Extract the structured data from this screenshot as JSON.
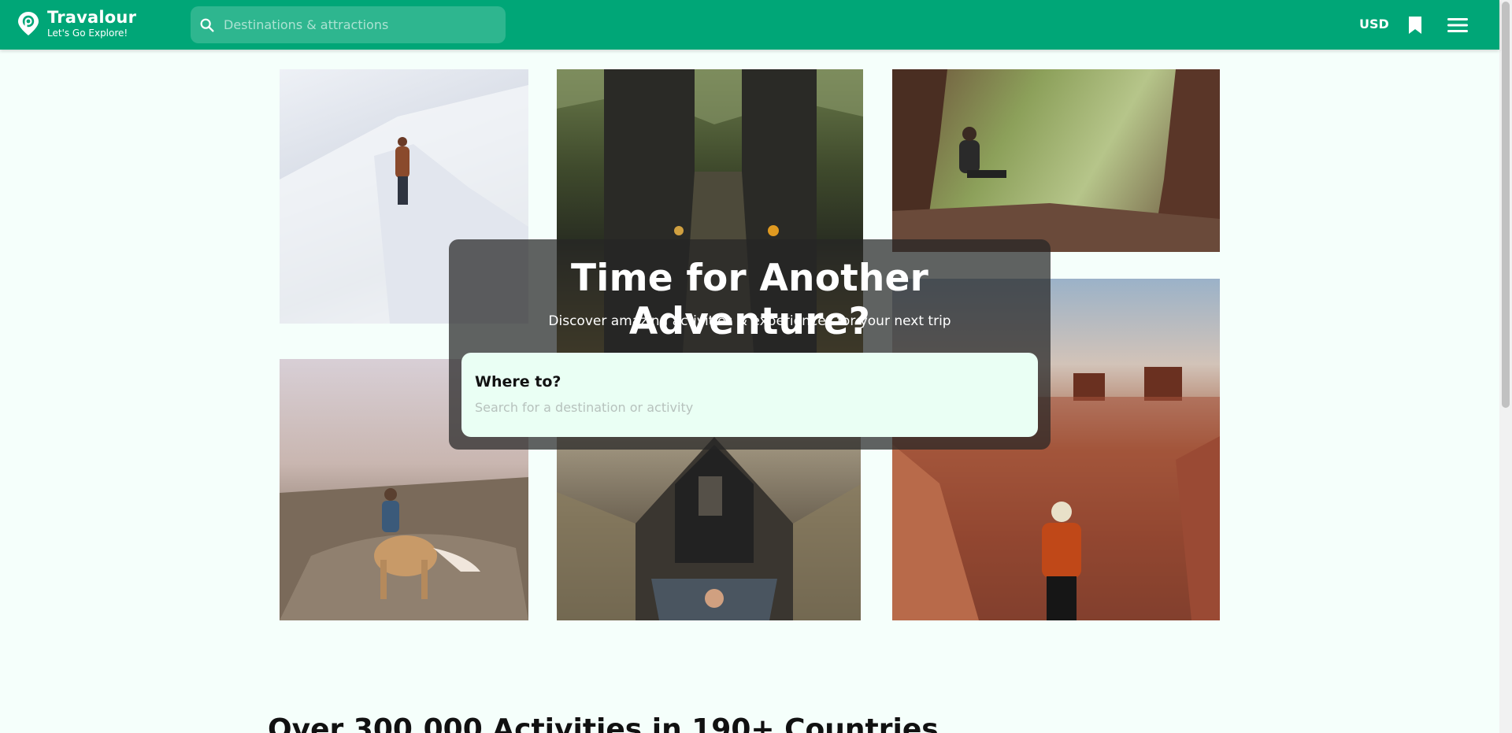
{
  "header": {
    "brand_name": "Travalour",
    "tagline": "Let's Go Explore!",
    "search_placeholder": "Destinations & attractions",
    "currency": "USD"
  },
  "hero": {
    "title": "Time for Another Adventure?",
    "subtitle": "Discover amazing activities & experiences for your next trip",
    "where_label": "Where to?",
    "where_placeholder": "Search for a destination or activity"
  },
  "section": {
    "heading": "Over 300,000 Activities in 190+ Countries"
  },
  "colors": {
    "brand": "#00a677",
    "page_bg": "#f5fffb",
    "hero_overlay": "#262626",
    "where_card_bg": "#eafff4"
  },
  "icons": [
    "logo-pin-icon",
    "search-icon",
    "bookmark-icon",
    "menu-icon"
  ]
}
